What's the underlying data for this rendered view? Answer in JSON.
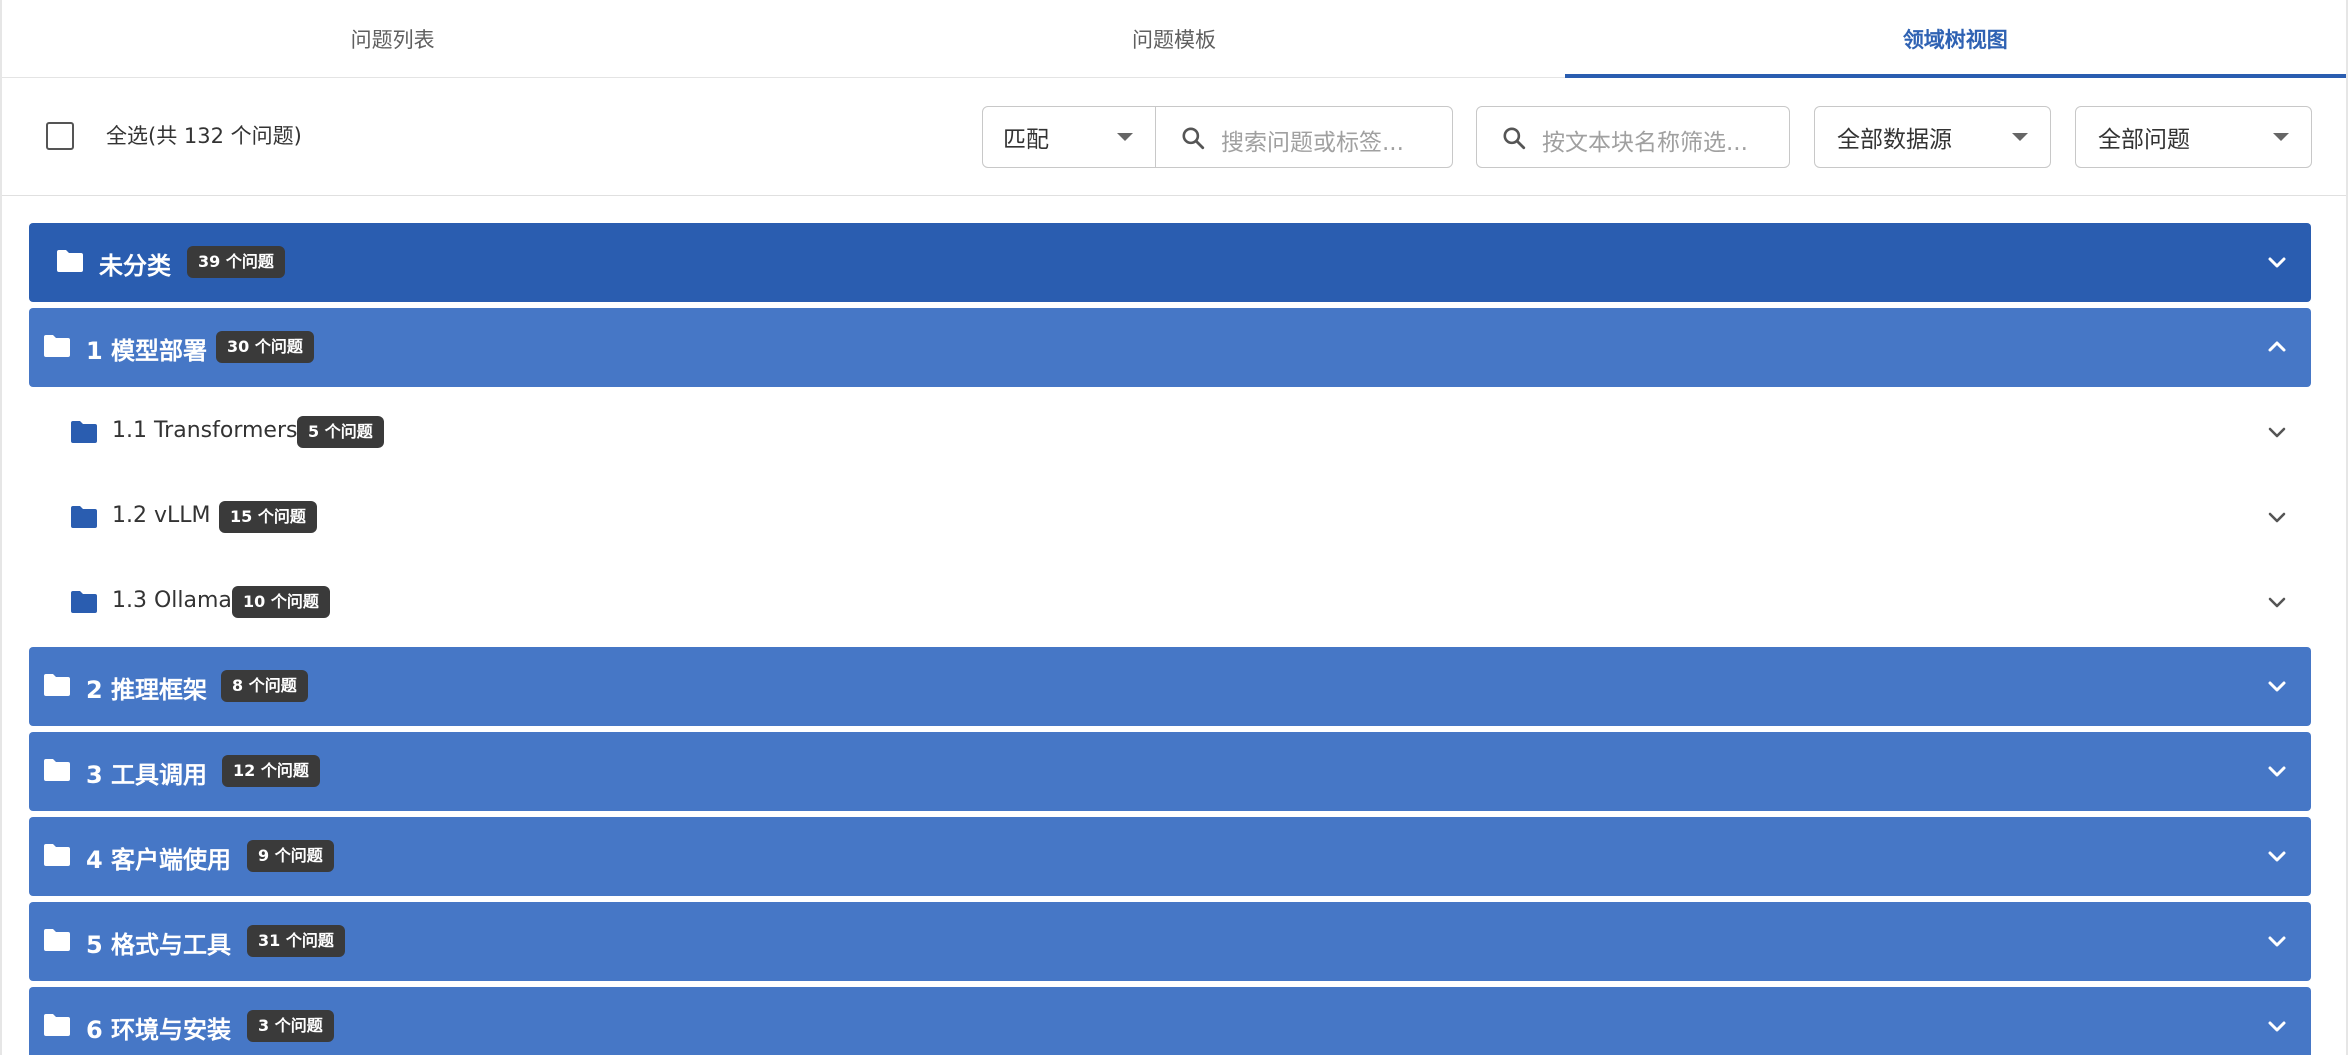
{
  "tabs": [
    {
      "label": "问题列表",
      "active": false
    },
    {
      "label": "问题模板",
      "active": false
    },
    {
      "label": "领域树视图",
      "active": true
    }
  ],
  "toolbar": {
    "select_all_label": "全选(共 132 个问题)",
    "match_mode": "匹配",
    "search_placeholder": "搜索问题或标签...",
    "chunk_placeholder": "按文本块名称筛选...",
    "source_filter": "全部数据源",
    "question_filter": "全部问题"
  },
  "tree": {
    "uncategorized": {
      "title": "未分类",
      "count": "39 个问题",
      "expanded": false
    },
    "d1": {
      "title": "1 模型部署",
      "count": "30 个问题",
      "expanded": true
    },
    "d1_1": {
      "title": "1.1 Transformers",
      "count": "5 个问题",
      "expanded": false
    },
    "d1_2": {
      "title": "1.2 vLLM",
      "count": "15 个问题",
      "expanded": false
    },
    "d1_3": {
      "title": "1.3 Ollama",
      "count": "10 个问题",
      "expanded": false
    },
    "d2": {
      "title": "2 推理框架",
      "count": "8 个问题",
      "expanded": false
    },
    "d3": {
      "title": "3 工具调用",
      "count": "12 个问题",
      "expanded": false
    },
    "d4": {
      "title": "4 客户端使用",
      "count": "9 个问题",
      "expanded": false
    },
    "d5": {
      "title": "5 格式与工具",
      "count": "31 个问题",
      "expanded": false
    },
    "d6": {
      "title": "6 环境与安装",
      "count": "3 个问题",
      "expanded": false
    }
  },
  "colors": {
    "accent": "#2a5db0",
    "domain_row": "#4677c6",
    "badge": "#3a3a3a"
  }
}
